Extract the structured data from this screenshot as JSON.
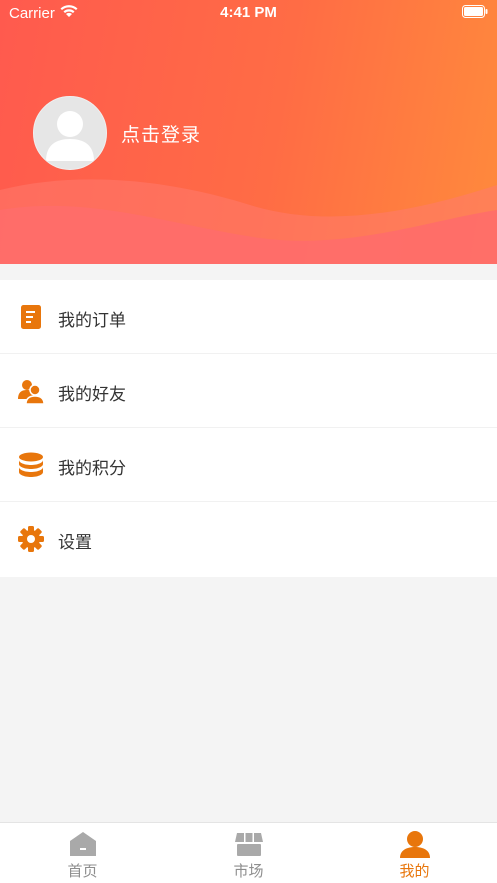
{
  "status_bar": {
    "carrier": "Carrier",
    "time": "4:41 PM"
  },
  "profile": {
    "login_text": "点击登录"
  },
  "menu": {
    "items": [
      {
        "label": "我的订单",
        "icon": "order-icon"
      },
      {
        "label": "我的好友",
        "icon": "friends-icon"
      },
      {
        "label": "我的积分",
        "icon": "points-icon"
      },
      {
        "label": "设置",
        "icon": "gear-icon"
      }
    ]
  },
  "tabbar": {
    "tabs": [
      {
        "label": "首页",
        "icon": "home-icon",
        "active": false
      },
      {
        "label": "市场",
        "icon": "store-icon",
        "active": false
      },
      {
        "label": "我的",
        "icon": "user-icon",
        "active": true
      }
    ]
  },
  "colors": {
    "accent": "#e8760c",
    "header_start": "#ff5a4e",
    "header_end": "#ff8a3c",
    "inactive": "#8e8e8e"
  }
}
